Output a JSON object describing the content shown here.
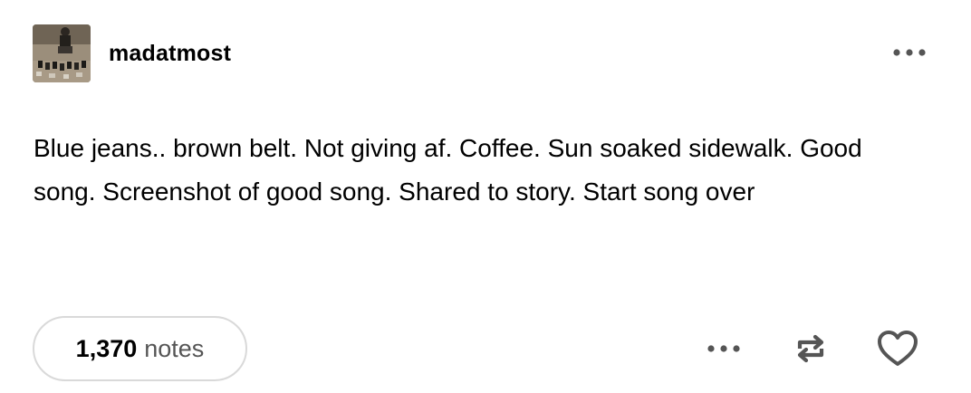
{
  "post": {
    "username": "madatmost",
    "body": "Blue jeans.. brown belt. Not giving af. Coffee. Sun soaked sidewalk. Good song. Screenshot of good song. Shared to story. Start song over",
    "notes_count": "1,370",
    "notes_label": "notes"
  },
  "icons": {
    "header_more": "ellipsis-icon",
    "footer_more": "ellipsis-icon",
    "reblog": "reblog-icon",
    "like": "heart-icon"
  },
  "colors": {
    "text": "#000000",
    "muted": "#555555",
    "pill_border": "#d9d9d9",
    "icon": "#555555"
  }
}
